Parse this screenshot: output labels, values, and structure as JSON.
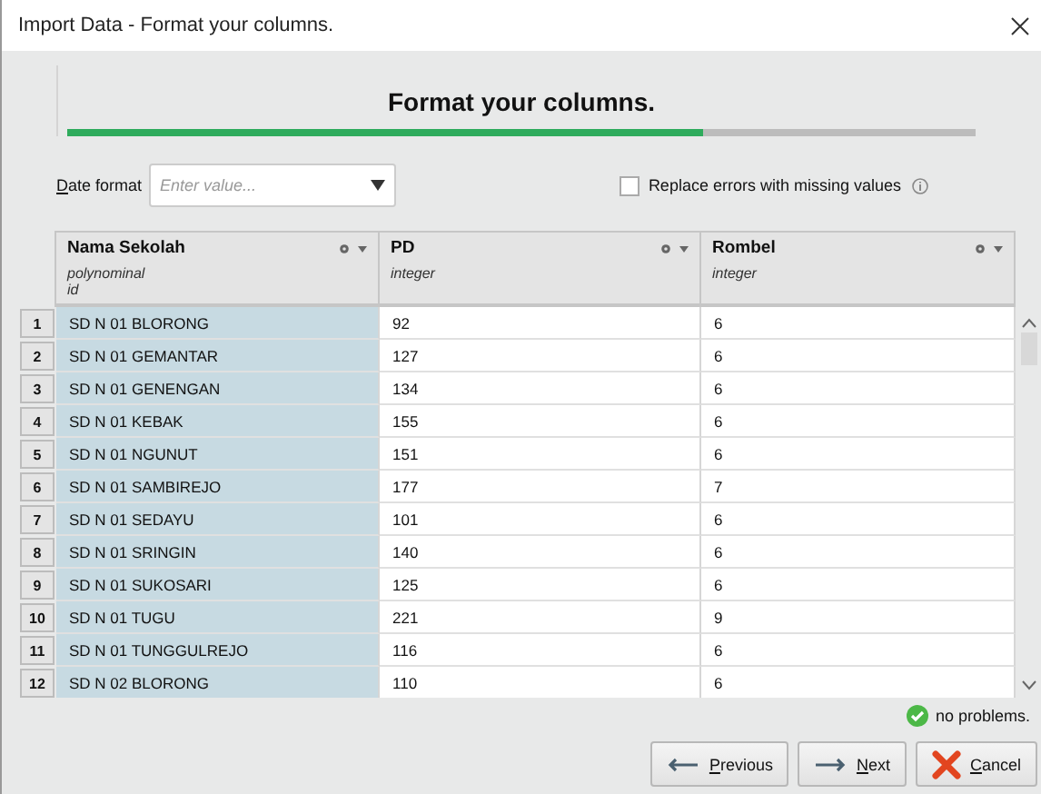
{
  "window": {
    "title": "Import Data - Format your columns."
  },
  "step": {
    "title": "Format your columns.",
    "level": 0.7
  },
  "date_format": {
    "label": "Date format",
    "placeholder": "Enter value..."
  },
  "replace_errors": {
    "label": "Replace errors with missing values",
    "checked": false
  },
  "table": {
    "columns": [
      {
        "name": "Nama Sekolah",
        "type": "polynominal",
        "role": "id",
        "highlighted": true
      },
      {
        "name": "PD",
        "type": "integer",
        "highlighted": false
      },
      {
        "name": "Rombel",
        "type": "integer",
        "highlighted": false
      }
    ],
    "rows": [
      {
        "row_number": "1",
        "cells": [
          "SD N 01 BLORONG",
          "92",
          "6"
        ]
      },
      {
        "row_number": "2",
        "cells": [
          "SD N 01 GEMANTAR",
          "127",
          "6"
        ]
      },
      {
        "row_number": "3",
        "cells": [
          "SD N 01 GENENGAN",
          "134",
          "6"
        ]
      },
      {
        "row_number": "4",
        "cells": [
          "SD N 01 KEBAK",
          "155",
          "6"
        ]
      },
      {
        "row_number": "5",
        "cells": [
          "SD N 01 NGUNUT",
          "151",
          "6"
        ]
      },
      {
        "row_number": "6",
        "cells": [
          "SD N 01 SAMBIREJO",
          "177",
          "7"
        ]
      },
      {
        "row_number": "7",
        "cells": [
          "SD N 01 SEDAYU",
          "101",
          "6"
        ]
      },
      {
        "row_number": "8",
        "cells": [
          "SD N 01 SRINGIN",
          "140",
          "6"
        ]
      },
      {
        "row_number": "9",
        "cells": [
          "SD N 01 SUKOSARI",
          "125",
          "6"
        ]
      },
      {
        "row_number": "10",
        "cells": [
          "SD N 01 TUGU",
          "221",
          "9"
        ]
      },
      {
        "row_number": "11",
        "cells": [
          "SD N 01 TUNGGULREJO",
          "116",
          "6"
        ]
      },
      {
        "row_number": "12",
        "cells": [
          "SD N 02 BLORONG",
          "110",
          "6"
        ]
      }
    ]
  },
  "status": {
    "text": "no problems.",
    "ok": true
  },
  "buttons": [
    {
      "kind": "previous",
      "label": "Previous"
    },
    {
      "kind": "next",
      "label": "Next"
    },
    {
      "kind": "cancel",
      "label": "Cancel"
    }
  ]
}
